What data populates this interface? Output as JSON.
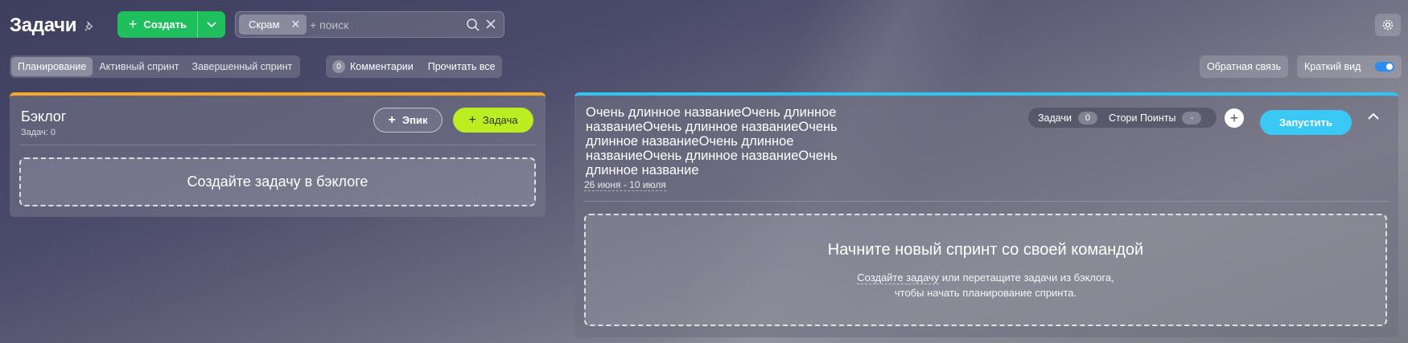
{
  "header": {
    "title": "Задачи",
    "create_label": "Создать",
    "search": {
      "chip": "Скрам",
      "placeholder": "+ поиск"
    }
  },
  "tabs": [
    {
      "label": "Планирование",
      "active": true
    },
    {
      "label": "Активный спринт",
      "active": false
    },
    {
      "label": "Завершенный спринт",
      "active": false
    }
  ],
  "comments": {
    "count": "0",
    "label": "Комментарии",
    "read_all": "Прочитать все"
  },
  "feedback_label": "Обратная связь",
  "short_view": {
    "label": "Краткий вид",
    "enabled": true
  },
  "backlog": {
    "title": "Бэклог",
    "subtitle": "Задач: 0",
    "epic_label": "Эпик",
    "task_label": "Задача",
    "dropzone": "Создайте задачу в бэклоге",
    "accent": "#f7a823"
  },
  "sprint": {
    "title": "Очень длинное названиеОчень длинное названиеОчень длинное названиеОчень длинное названиеОчень длинное названиеОчень длинное названиеОчень длинное название",
    "dates": "26 июня - 10 июля",
    "tasks_label": "Задачи",
    "tasks_count": "0",
    "points_label": "Стори Поинты",
    "points_value": "-",
    "start_label": "Запустить",
    "dropzone_title": "Начните новый спринт со своей командой",
    "dropzone_link": "Создайте задачу",
    "dropzone_text1": " или перетащите задачи из бэклога,",
    "dropzone_text2": "чтобы начать планирование спринта.",
    "accent": "#2fc6f6"
  },
  "icons": [
    "pin-icon",
    "chevron-down-icon",
    "search-icon",
    "close-icon",
    "gear-icon",
    "plus-icon",
    "chevron-up-icon"
  ]
}
